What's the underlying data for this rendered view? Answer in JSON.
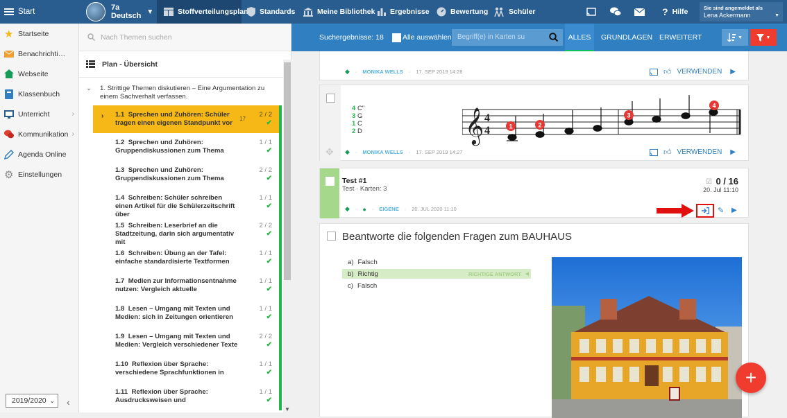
{
  "topbar": {
    "start": "Start",
    "class_name": "7a",
    "class_subject": "Deutsch",
    "tabs": [
      "Stoffverteilungsplan",
      "Standards",
      "Meine Bibliothek",
      "Ergebnisse",
      "Bewertung",
      "Schüler"
    ],
    "help": "Hilfe",
    "login_label": "Sie sind angemeldet als",
    "user": "Lena Ackermann"
  },
  "sidebar": {
    "items": [
      "Startseite",
      "Benachrichtigu...",
      "Webseite",
      "Klassenbuch",
      "Unterricht",
      "Kommunikation",
      "Agenda Online",
      "Einstellungen"
    ],
    "year": "2019/2020"
  },
  "plan": {
    "search_placeholder": "Nach Themen suchen",
    "title": "Plan - Übersicht",
    "group": "1. Strittige Themen diskutieren – Eine Argumentation zu einem Sachverhalt verfassen.",
    "topics": [
      {
        "num": "1.1",
        "title": "Sprechen und Zuhören: Schüler tragen einen eigenen Standpunkt vor",
        "count": "2 / 2",
        "extra": "17"
      },
      {
        "num": "1.2",
        "title": "Sprechen und Zuhören: Gruppendiskussionen zum Thema",
        "count": "1 / 1"
      },
      {
        "num": "1.3",
        "title": "Sprechen und Zuhören: Gruppendiskussionen zum Thema",
        "count": "2 / 2"
      },
      {
        "num": "1.4",
        "title": "Schreiben: Schüler schreiben einen Artikel für die Schülerzeitschrift über",
        "count": "1 / 1"
      },
      {
        "num": "1.5",
        "title": "Schreiben: Leserbrief an die Stadtzeitung, darin sich argumentativ mit",
        "count": "2 / 2"
      },
      {
        "num": "1.6",
        "title": "Schreiben: Übung an der Tafel: einfache standardisierte Textformen",
        "count": "1 / 1"
      },
      {
        "num": "1.7",
        "title": "Medien zur Informationsentnahme nutzen: Vergleich aktuelle",
        "count": "1 / 1"
      },
      {
        "num": "1.8",
        "title": "Lesen – Umgang mit Texten und Medien: sich in Zeitungen orientieren",
        "count": "1 / 1"
      },
      {
        "num": "1.9",
        "title": "Lesen – Umgang mit Texten und Medien: Vergleich verschiedener Texte",
        "count": "2 / 2"
      },
      {
        "num": "1.10",
        "title": "Reflexion über Sprache: verschiedene Sprachfunktionen in",
        "count": "1 / 1"
      },
      {
        "num": "1.11",
        "title": "Reflexion über Sprache: Ausdrucksweisen und",
        "count": "1 / 1"
      }
    ]
  },
  "toolbar": {
    "results": "Suchergebnisse: 18",
    "select_all": "Alle auswählen",
    "keyword_placeholder": "Begriff(e) in Karten su",
    "tabs": [
      "ALLES",
      "GRUNDLAGEN",
      "ERWEITERT"
    ]
  },
  "cards": {
    "c1": {
      "author": "MONIKA WELLS",
      "date": "17. SEP 2019 14:28",
      "use": "VERWENDEN"
    },
    "c2": {
      "author": "MONIKA WELLS",
      "date": "17. SEP 2019 14:27",
      "use": "VERWENDEN",
      "notes": [
        {
          "num": "4",
          "note": "C''"
        },
        {
          "num": "3",
          "note": "G"
        },
        {
          "num": "1",
          "note": "C"
        },
        {
          "num": "2",
          "note": "D"
        }
      ],
      "markers": [
        "1",
        "2",
        "3",
        "4"
      ]
    },
    "c3": {
      "title": "Test #1",
      "sub": "Test · Karten: 3",
      "score": "0 / 16",
      "score_date": "20. Jul 11:10",
      "owner": "EIGENE",
      "date": "20. JUL 2020 11:10"
    },
    "c4": {
      "question": "Beantworte die folgenden Fragen zum BAUHAUS",
      "answers": [
        {
          "key": "a)",
          "text": "Falsch"
        },
        {
          "key": "b)",
          "text": "Richtig"
        },
        {
          "key": "c)",
          "text": "Falsch"
        }
      ],
      "correct": "RICHTIGE ANTWORT"
    }
  },
  "colors": {
    "topbar": "#2a5d8f",
    "toolbar": "#2f7fc1",
    "active_topic": "#f5b816",
    "progress": "#20b84a",
    "fab": "#f03c2e",
    "highlight": "#e01010"
  }
}
